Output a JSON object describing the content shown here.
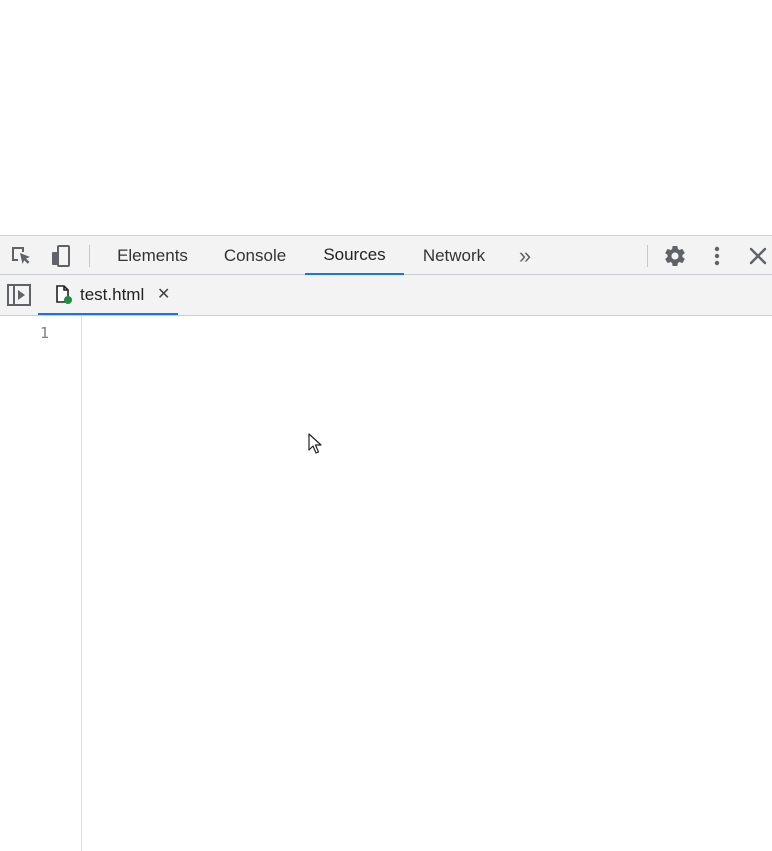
{
  "toolbar": {
    "tabs": [
      {
        "label": "Elements"
      },
      {
        "label": "Console"
      },
      {
        "label": "Sources"
      },
      {
        "label": "Network"
      }
    ],
    "active_tab": "Sources",
    "more_tabs_glyph": "»",
    "icons": [
      "inspect-element-icon",
      "device-toggle-icon",
      "more-tabs-icon",
      "settings-gear-icon",
      "kebab-menu-icon",
      "close-icon"
    ]
  },
  "sources": {
    "navigator_toggle_icon": "show-navigator-icon",
    "open_file": {
      "name": "test.html",
      "close_glyph": "✕",
      "status_color": "#1e8e3e"
    }
  },
  "editor": {
    "line_numbers": [
      "1"
    ]
  },
  "colors": {
    "accent": "#1a73e8",
    "toolbar_bg": "#f3f3f3"
  }
}
